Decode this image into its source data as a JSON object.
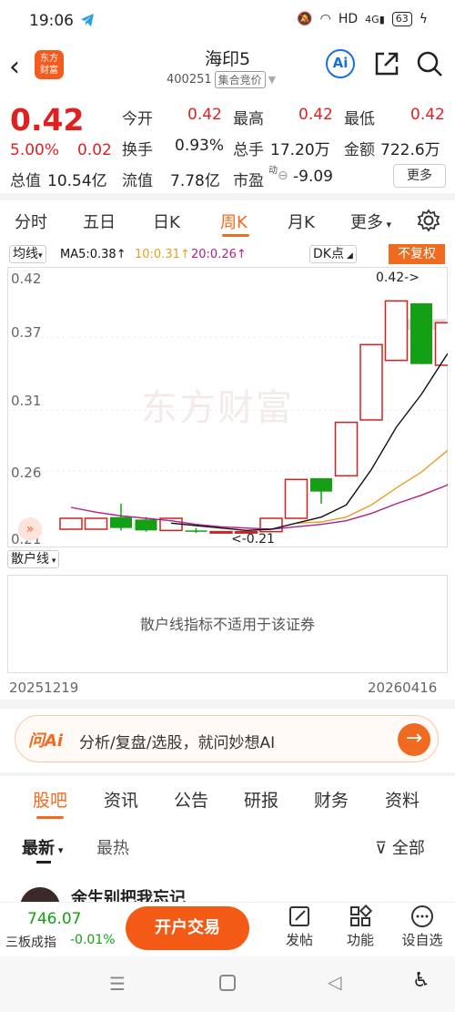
{
  "status_bar": {
    "time": "19:06",
    "network": "HD",
    "signal": "4G",
    "battery": "63"
  },
  "header": {
    "logo_line1": "东方",
    "logo_line2": "财富",
    "title": "海印5",
    "code": "400251",
    "auction_tag": "集合竞价",
    "ai_label": "Ai"
  },
  "quote": {
    "price": "0.42",
    "change_pct": "5.00%",
    "change": "0.02",
    "open_label": "今开",
    "open": "0.42",
    "high_label": "最高",
    "high": "0.42",
    "low_label": "最低",
    "low": "0.42",
    "turnover_rate_label": "换手",
    "turnover_rate": "0.93%",
    "volume_label": "总手",
    "volume": "17.20万",
    "amount_label": "金额",
    "amount": "722.6万",
    "total_cap_label": "总值",
    "total_cap": "10.54亿",
    "float_cap_label": "流值",
    "float_cap": "7.78亿",
    "pe_label": "市盈",
    "pe_sup": "动",
    "pe": "-9.09",
    "more_label": "更多"
  },
  "period_tabs": [
    "分时",
    "五日",
    "日K",
    "周K",
    "月K",
    "更多"
  ],
  "active_period": "周K",
  "indicators": {
    "main_select": "均线",
    "ma5": "MA5:0.38↑",
    "ma10": "10:0.31↑",
    "ma20": "20:0.26↑",
    "dk_select": "DK点",
    "adjust": "不复权",
    "ma5_color": "#111111",
    "ma10_color": "#e5a020",
    "ma20_color": "#b0208a"
  },
  "chart_data": {
    "type": "candlestick",
    "y_ticks": [
      "0.42",
      "0.37",
      "0.31",
      "0.26",
      "0.21"
    ],
    "ylim": [
      0.2,
      0.425
    ],
    "max_label": "0.42->",
    "min_label": "<-0.21",
    "watermark": "东方财富",
    "candles": [
      {
        "open": 0.212,
        "close": 0.221,
        "high": 0.221,
        "low": 0.212
      },
      {
        "open": 0.212,
        "close": 0.221,
        "high": 0.221,
        "low": 0.212
      },
      {
        "open": 0.222,
        "close": 0.213,
        "high": 0.233,
        "low": 0.211
      },
      {
        "open": 0.22,
        "close": 0.211,
        "high": 0.222,
        "low": 0.21
      },
      {
        "open": 0.211,
        "close": 0.221,
        "high": 0.221,
        "low": 0.211
      },
      {
        "open": 0.211,
        "close": 0.21,
        "high": 0.213,
        "low": 0.209
      },
      {
        "open": 0.21,
        "close": 0.21,
        "high": 0.21,
        "low": 0.21
      },
      {
        "open": 0.21,
        "close": 0.21,
        "high": 0.21,
        "low": 0.21
      },
      {
        "open": 0.21,
        "close": 0.221,
        "high": 0.221,
        "low": 0.21
      },
      {
        "open": 0.221,
        "close": 0.253,
        "high": 0.253,
        "low": 0.221
      },
      {
        "open": 0.254,
        "close": 0.243,
        "high": 0.254,
        "low": 0.233
      },
      {
        "open": 0.256,
        "close": 0.3,
        "high": 0.3,
        "low": 0.256
      },
      {
        "open": 0.302,
        "close": 0.364,
        "high": 0.364,
        "low": 0.302
      },
      {
        "open": 0.351,
        "close": 0.4,
        "high": 0.4,
        "low": 0.351
      },
      {
        "open": 0.398,
        "close": 0.348,
        "high": 0.398,
        "low": 0.348
      },
      {
        "open": 0.347,
        "close": 0.382,
        "high": 0.382,
        "low": 0.347
      },
      {
        "open": 0.35,
        "close": 0.42,
        "high": 0.42,
        "low": 0.35
      }
    ],
    "ma5": [
      null,
      null,
      null,
      null,
      0.217,
      0.215,
      0.213,
      0.211,
      0.212,
      0.217,
      0.222,
      0.232,
      0.261,
      0.296,
      0.323,
      0.355,
      0.381
    ],
    "ma10": [
      null,
      null,
      null,
      null,
      null,
      null,
      null,
      null,
      null,
      0.217,
      0.218,
      0.222,
      0.232,
      0.246,
      0.259,
      0.276,
      0.295,
      0.312
    ],
    "ma20": [
      0.23,
      0.226,
      0.223,
      0.221,
      0.219,
      0.216,
      0.214,
      0.213,
      0.212,
      0.214,
      0.216,
      0.219,
      0.225,
      0.233,
      0.24,
      0.248,
      0.263
    ],
    "date_start": "20251219",
    "date_end": "20260416"
  },
  "sub_indicator": {
    "select": "散户线",
    "message": "散户线指标不适用于该证券"
  },
  "ai_bar": {
    "logo": "问Ai",
    "text": "分析/复盘/选股，就问妙想AI",
    "go": "→"
  },
  "forum_tabs": [
    "股吧",
    "资讯",
    "公告",
    "研报",
    "财务",
    "资料"
  ],
  "sort": {
    "newest": "最新",
    "hottest": "最热",
    "filter": "全部"
  },
  "post_preview": "余生别把我忘记",
  "bottom_bar": {
    "index_value": "746.07",
    "index_name": "三板成指",
    "index_pct": "-0.01%",
    "trade_button": "开户交易",
    "post": "发帖",
    "functions": "功能",
    "custom": "设自选"
  }
}
